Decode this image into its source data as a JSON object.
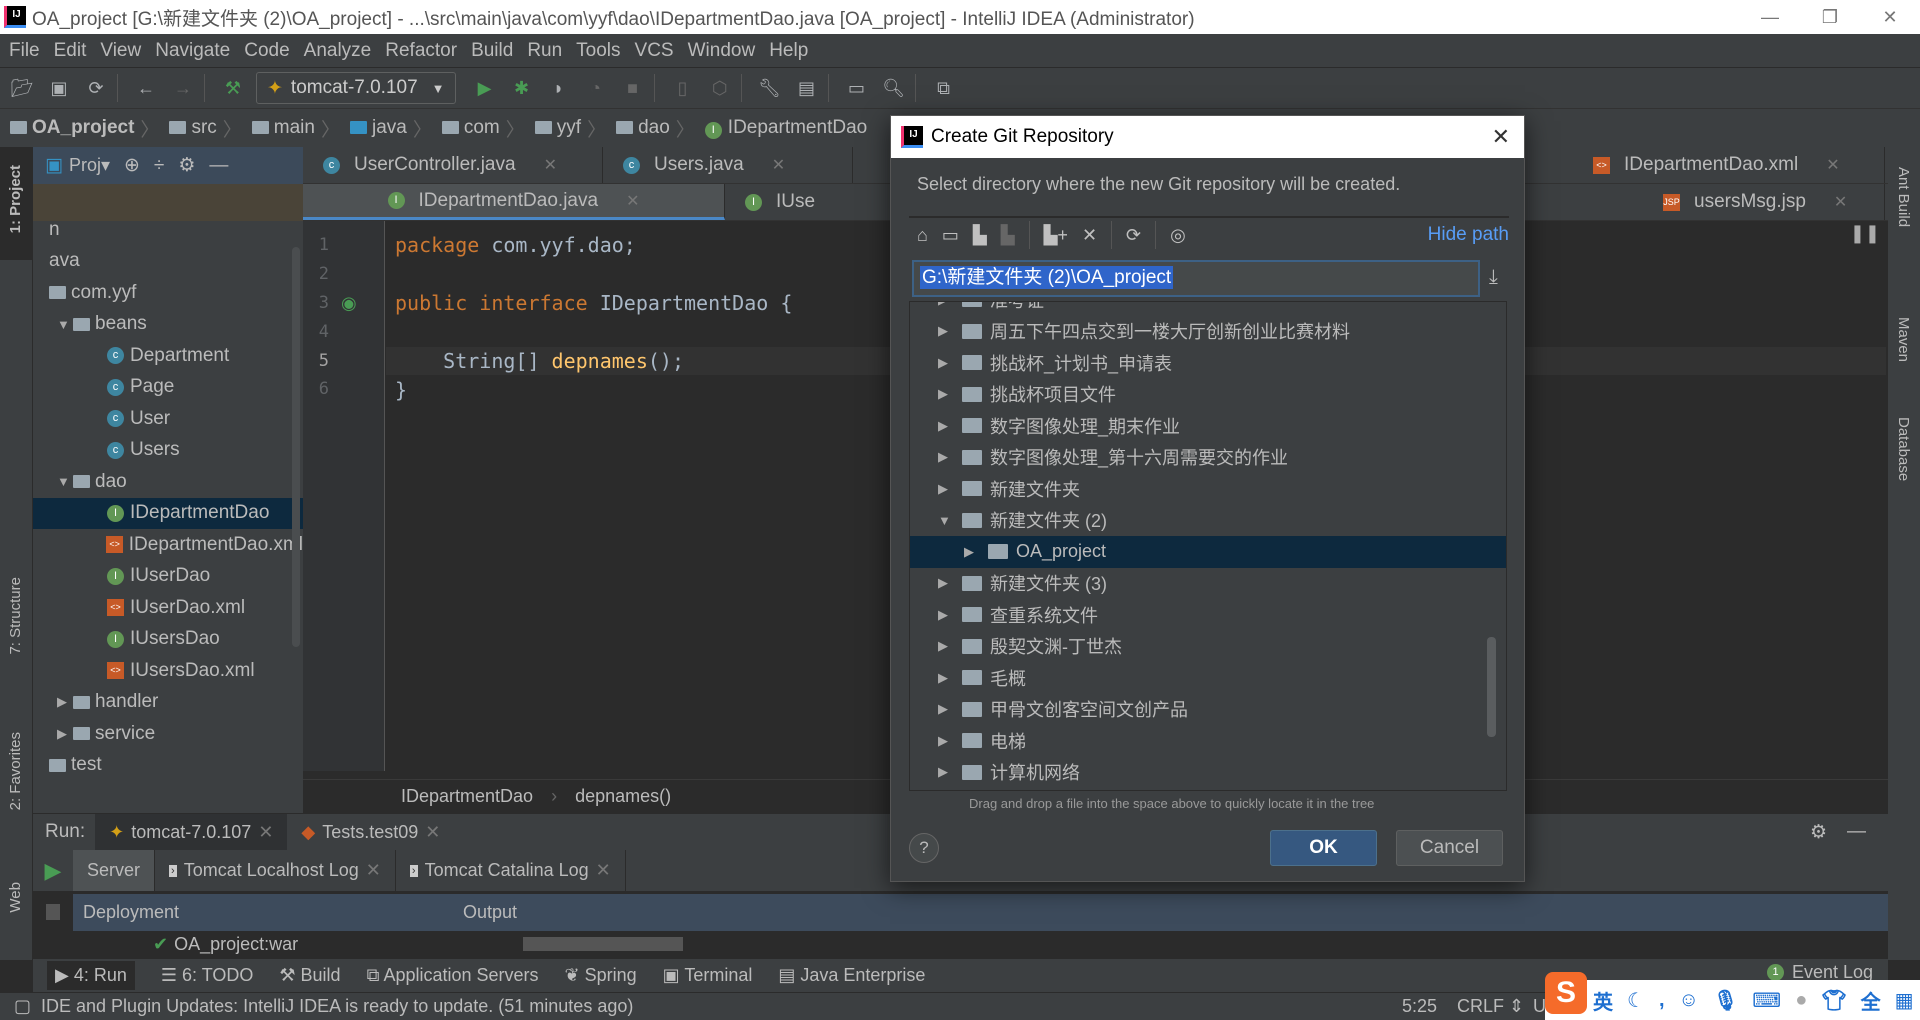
{
  "window": {
    "title": "OA_project [G:\\新建文件夹 (2)\\OA_project] - ...\\src\\main\\java\\com\\yyf\\dao\\IDepartmentDao.java [OA_project] - IntelliJ IDEA (Administrator)",
    "minimize": "—",
    "restore": "❐",
    "close": "✕"
  },
  "menu": [
    "File",
    "Edit",
    "View",
    "Navigate",
    "Code",
    "Analyze",
    "Refactor",
    "Build",
    "Run",
    "Tools",
    "VCS",
    "Window",
    "Help"
  ],
  "toolbar": {
    "run_config": "tomcat-7.0.107"
  },
  "breadcrumb": [
    "OA_project",
    "src",
    "main",
    "java",
    "com",
    "yyf",
    "dao",
    "IDepartmentDao"
  ],
  "project_panel": {
    "title": "Proj▾",
    "tree": [
      {
        "label": "n",
        "indent": 0,
        "icon": "none"
      },
      {
        "label": "ava",
        "indent": 0,
        "icon": "none"
      },
      {
        "label": "com.yyf",
        "indent": 0,
        "icon": "package"
      },
      {
        "label": "beans",
        "indent": 1,
        "icon": "package",
        "expanded": true
      },
      {
        "label": "Department",
        "indent": 2,
        "icon": "class"
      },
      {
        "label": "Page",
        "indent": 2,
        "icon": "class"
      },
      {
        "label": "User",
        "indent": 2,
        "icon": "class"
      },
      {
        "label": "Users",
        "indent": 2,
        "icon": "class"
      },
      {
        "label": "dao",
        "indent": 1,
        "icon": "package",
        "expanded": true
      },
      {
        "label": "IDepartmentDao",
        "indent": 2,
        "icon": "interface",
        "selected": true
      },
      {
        "label": "IDepartmentDao.xml",
        "indent": 2,
        "icon": "xml"
      },
      {
        "label": "IUserDao",
        "indent": 2,
        "icon": "interface"
      },
      {
        "label": "IUserDao.xml",
        "indent": 2,
        "icon": "xml"
      },
      {
        "label": "IUsersDao",
        "indent": 2,
        "icon": "interface"
      },
      {
        "label": "IUsersDao.xml",
        "indent": 2,
        "icon": "xml"
      },
      {
        "label": "handler",
        "indent": 1,
        "icon": "package",
        "expanded": false
      },
      {
        "label": "service",
        "indent": 1,
        "icon": "package",
        "expanded": false
      },
      {
        "label": "test",
        "indent": 0,
        "icon": "package"
      }
    ]
  },
  "left_stripe": [
    "1: Project",
    "7: Structure",
    "2: Favorites",
    "Web"
  ],
  "right_stripe": [
    "Ant Build",
    "Maven",
    "Database"
  ],
  "editor": {
    "tabs_row1": [
      "UserController.java",
      "Users.java",
      "IDepartmentDao.xml"
    ],
    "tabs_row2": [
      "IDepartmentDao.java",
      "IUse",
      "usersMsg.jsp"
    ],
    "lines": [
      "1",
      "2",
      "3",
      "4",
      "5",
      "6"
    ],
    "code": {
      "l1_kw": "package",
      "l1": " com.yyf.dao;",
      "l3_kw": "public interface",
      "l3": " IDepartmentDao {",
      "l5_a": "    String[] ",
      "l5_fn": "depnames",
      "l5_b": "();",
      "l6": "}"
    },
    "crumb": [
      "IDepartmentDao",
      "depnames()"
    ]
  },
  "run": {
    "label": "Run:",
    "tabs": [
      "tomcat-7.0.107",
      "Tests.test09"
    ],
    "subtabs": [
      "Server",
      "Tomcat Localhost Log",
      "Tomcat Catalina Log"
    ],
    "col_deployment": "Deployment",
    "col_output": "Output",
    "deployment": "OA_project:war"
  },
  "bottom_tools": [
    "4: Run",
    "6: TODO",
    "Build",
    "Application Servers",
    "Spring",
    "Terminal",
    "Java Enterprise"
  ],
  "event_log": {
    "count": "1",
    "label": "Event Log"
  },
  "status": {
    "message": "IDE and Plugin Updates: IntelliJ IDEA is ready to update. (51 minutes ago)",
    "position": "5:25",
    "line_sep": "CRLF",
    "encoding": "U"
  },
  "ime": {
    "lang": "英"
  },
  "dialog": {
    "title": "Create Git Repository",
    "subtitle": "Select directory where the new Git repository will be created.",
    "hide_path": "Hide path",
    "path": "G:\\新建文件夹 (2)\\OA_project",
    "tree": [
      {
        "label": "准考证",
        "indent": 0
      },
      {
        "label": "周五下午四点交到一楼大厅创新创业比赛材料",
        "indent": 0
      },
      {
        "label": "挑战杯_计划书_申请表",
        "indent": 0
      },
      {
        "label": "挑战杯项目文件",
        "indent": 0
      },
      {
        "label": "数字图像处理_期末作业",
        "indent": 0
      },
      {
        "label": "数字图像处理_第十六周需要交的作业",
        "indent": 0
      },
      {
        "label": "新建文件夹",
        "indent": 0
      },
      {
        "label": "新建文件夹 (2)",
        "indent": 0,
        "expanded": true
      },
      {
        "label": "OA_project",
        "indent": 1,
        "selected": true
      },
      {
        "label": "新建文件夹 (3)",
        "indent": 0
      },
      {
        "label": "查重系统文件",
        "indent": 0
      },
      {
        "label": "殷契文渊-丁世杰",
        "indent": 0
      },
      {
        "label": "毛概",
        "indent": 0
      },
      {
        "label": "甲骨文创客空间文创产品",
        "indent": 0
      },
      {
        "label": "电梯",
        "indent": 0
      },
      {
        "label": "计算机网络",
        "indent": 0
      }
    ],
    "hint": "Drag and drop a file into the space above to quickly locate it in the tree",
    "help": "?",
    "ok": "OK",
    "cancel": "Cancel"
  },
  "colors": {
    "accent": "#365880",
    "selection": "#0d293e",
    "link": "#589df6",
    "run_green": "#499c54"
  }
}
